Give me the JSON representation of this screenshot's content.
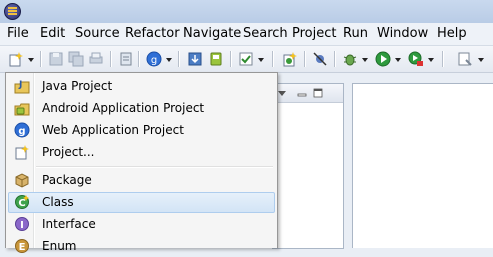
{
  "menubar": {
    "items": [
      "File",
      "Edit",
      "Source",
      "Refactor",
      "Navigate",
      "Search",
      "Project",
      "Run",
      "Window",
      "Help"
    ]
  },
  "new_menu": {
    "group1": [
      {
        "label": "Java Project",
        "icon": "java-project-icon"
      },
      {
        "label": "Android Application Project",
        "icon": "android-project-icon"
      },
      {
        "label": "Web Application Project",
        "icon": "gwt-web-app-icon"
      },
      {
        "label": "Project...",
        "icon": "generic-project-icon"
      }
    ],
    "group2": [
      {
        "label": "Package",
        "icon": "package-icon"
      },
      {
        "label": "Class",
        "icon": "class-icon",
        "highlighted": true
      },
      {
        "label": "Interface",
        "icon": "interface-icon"
      },
      {
        "label": "Enum",
        "icon": "enum-icon"
      }
    ]
  },
  "colors": {
    "highlight_fill": "#dbe8f8",
    "highlight_border": "#aecdee",
    "menu_bg": "#f5f5f5",
    "titlebar": "#c9d9ee"
  }
}
